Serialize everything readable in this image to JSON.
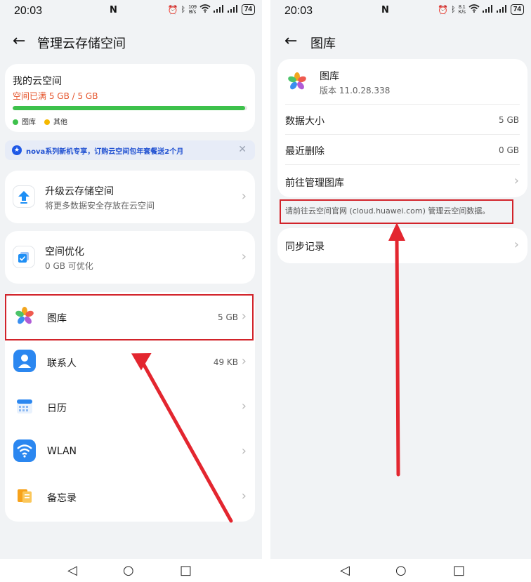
{
  "left": {
    "status": {
      "time": "20:03",
      "nfc": "N",
      "speed_top": "109",
      "speed_bottom": "B/s",
      "battery": "74"
    },
    "header": {
      "back_icon": "arrow-left-icon",
      "title": "管理云存储空间"
    },
    "storage": {
      "label": "我的云空间",
      "status": "空间已满 5 GB / 5 GB",
      "used_fraction": 0.99,
      "legend": [
        {
          "label": "图库",
          "color": "#3dc14b"
        },
        {
          "label": "其他",
          "color": "#f5b800"
        }
      ]
    },
    "banner": {
      "text": "nova系列新机专享，订购云空间包年套餐送2个月"
    },
    "upgrade": {
      "title": "升级云存储空间",
      "subtitle": "将更多数据安全存放在云空间"
    },
    "optimize": {
      "title": "空间优化",
      "subtitle": "0 GB 可优化"
    },
    "apps": [
      {
        "name": "图库",
        "value": "5 GB"
      },
      {
        "name": "联系人",
        "value": "49 KB"
      },
      {
        "name": "日历",
        "value": ""
      },
      {
        "name": "WLAN",
        "value": ""
      },
      {
        "name": "备忘录",
        "value": ""
      }
    ],
    "colors": {
      "accent_red": "#d2232a",
      "warning": "#e5532a",
      "progress": "#3dc14b"
    }
  },
  "right": {
    "status": {
      "time": "20:03",
      "nfc": "N",
      "speed_top": "8.1",
      "speed_bottom": "K/s",
      "battery": "74"
    },
    "header": {
      "back_icon": "arrow-left-icon",
      "title": "图库"
    },
    "app": {
      "name": "图库",
      "version": "版本 11.0.28.338"
    },
    "rows": [
      {
        "label": "数据大小",
        "value": "5 GB"
      },
      {
        "label": "最近删除",
        "value": "0 GB"
      },
      {
        "label": "前往管理图库",
        "value": ""
      }
    ],
    "note": "请前往云空间官网 (cloud.huawei.com) 管理云空间数据。",
    "sync": {
      "label": "同步记录"
    }
  }
}
